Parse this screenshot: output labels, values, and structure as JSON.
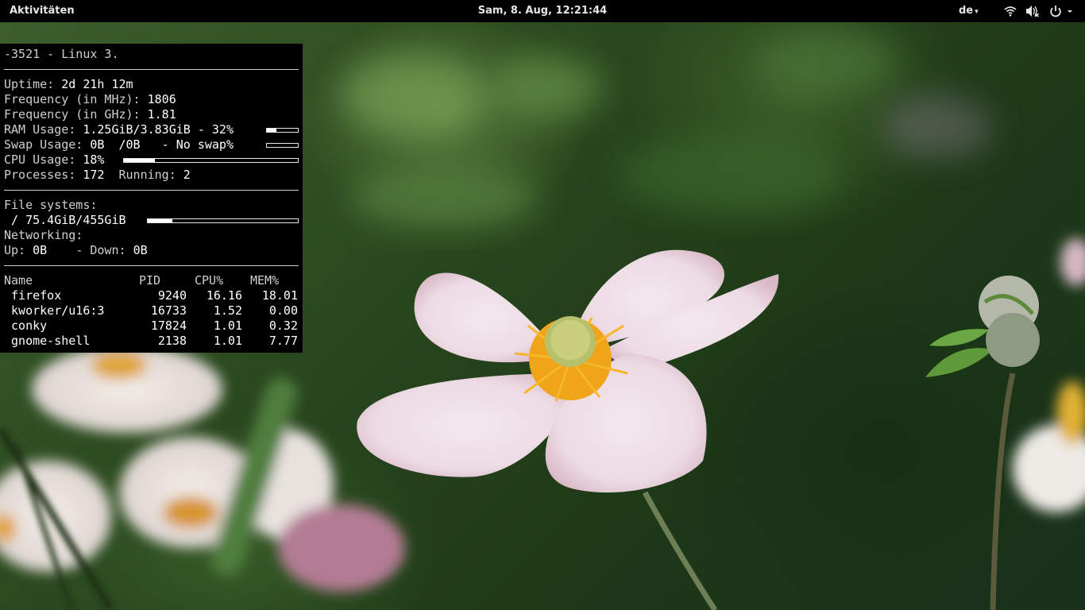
{
  "topbar": {
    "activities": "Aktivitäten",
    "clock": "Sam,  8. Aug, 12:21:44",
    "language": "de",
    "caret": "▾",
    "icons": [
      "wifi-icon",
      "volume-muted-icon",
      "power-icon"
    ]
  },
  "conky": {
    "header": "-3521 - Linux 3.",
    "uptime_label": "Uptime: ",
    "uptime": "2d 21h 12m",
    "freq_mhz_label": "Frequency (in MHz): ",
    "freq_mhz": "1806",
    "freq_ghz_label": "Frequency (in GHz): ",
    "freq_ghz": "1.81",
    "ram_label": "RAM Usage: ",
    "ram_value": "1.25GiB/3.83GiB - 32%",
    "ram_percent": 32,
    "swap_label": "Swap Usage: ",
    "swap_value": "0B  /0B   - No swap%",
    "swap_percent": 0,
    "cpu_label": "CPU Usage: ",
    "cpu_value": "18%",
    "cpu_percent": 18,
    "processes_label": "Processes: ",
    "processes": "172",
    "running_label": "  Running: ",
    "running": "2",
    "fs_label": "File systems:",
    "fs_root": " / 75.4GiB/455GiB",
    "fs_percent": 16.5,
    "net_label": "Networking:",
    "up_label": "Up: ",
    "up": "0B",
    "down_label": "    - Down: ",
    "down": "0B",
    "table_headers": {
      "name": "Name",
      "pid": "PID",
      "cpu": "CPU%",
      "mem": "MEM%"
    },
    "processes_list": [
      {
        "name": " firefox",
        "pid": "9240",
        "cpu": "16.16",
        "mem": "18.01"
      },
      {
        "name": " kworker/u16:3",
        "pid": "16733",
        "cpu": "1.52",
        "mem": "0.00"
      },
      {
        "name": " conky",
        "pid": "17824",
        "cpu": "1.01",
        "mem": "0.32"
      },
      {
        "name": " gnome-shell",
        "pid": "2138",
        "cpu": "1.01",
        "mem": "7.77"
      }
    ]
  },
  "colors": {
    "topbar": "#000000",
    "conky_bg": "#000000",
    "conky_text": "#cfcfcf"
  }
}
